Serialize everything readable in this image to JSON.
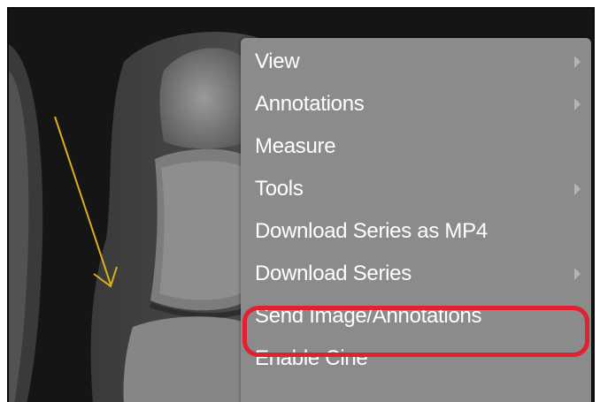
{
  "viewer": {
    "image_description": "foot-xray",
    "annotation_color": "#d8b11c"
  },
  "context_menu": {
    "items": [
      {
        "label": "View",
        "has_submenu": true
      },
      {
        "label": "Annotations",
        "has_submenu": true
      },
      {
        "label": "Measure",
        "has_submenu": false
      },
      {
        "label": "Tools",
        "has_submenu": true
      },
      {
        "label": "Download Series as MP4",
        "has_submenu": false
      },
      {
        "label": "Download Series",
        "has_submenu": true
      },
      {
        "label": "Send Image/Annotations",
        "has_submenu": false,
        "highlighted": true
      },
      {
        "label": "Enable Cine",
        "has_submenu": false
      }
    ]
  },
  "highlight": {
    "color": "#e0212f"
  }
}
